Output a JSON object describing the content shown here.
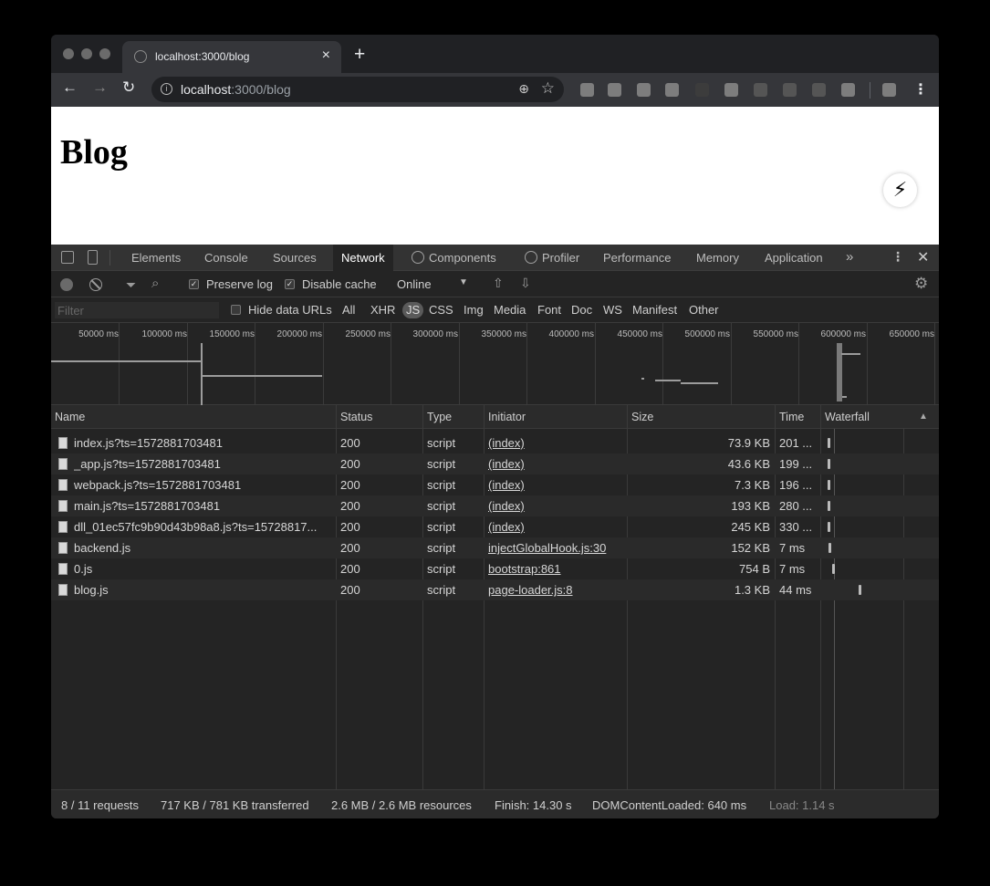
{
  "browser": {
    "tab_title": "localhost:3000/blog",
    "new_tab": "+",
    "tab_close": "×",
    "url_host": "localhost",
    "url_rest": ":3000/blog"
  },
  "page": {
    "heading": "Blog",
    "indicator_glyph": "⚡"
  },
  "devtools": {
    "tabs": [
      "Elements",
      "Console",
      "Sources",
      "Network",
      "Components",
      "Profiler",
      "Performance",
      "Memory",
      "Application"
    ],
    "active_tab": "Network",
    "more": "»"
  },
  "network_toolbar": {
    "preserve_log": "Preserve log",
    "preserve_log_checked": true,
    "disable_cache": "Disable cache",
    "disable_cache_checked": true,
    "throttling": "Online"
  },
  "filter_bar": {
    "placeholder": "Filter",
    "hide_data_urls": "Hide data URLs",
    "types": [
      "All",
      "XHR",
      "JS",
      "CSS",
      "Img",
      "Media",
      "Font",
      "Doc",
      "WS",
      "Manifest",
      "Other"
    ],
    "active_type": "JS"
  },
  "overview": {
    "ticks": [
      "50000 ms",
      "100000 ms",
      "150000 ms",
      "200000 ms",
      "250000 ms",
      "300000 ms",
      "350000 ms",
      "400000 ms",
      "450000 ms",
      "500000 ms",
      "550000 ms",
      "600000 ms",
      "650000 ms"
    ]
  },
  "table": {
    "columns": [
      "Name",
      "Status",
      "Type",
      "Initiator",
      "Size",
      "Time",
      "Waterfall"
    ],
    "rows": [
      {
        "name": "index.js?ts=1572881703481",
        "status": "200",
        "type": "script",
        "initiator": "(index)",
        "size": "73.9 KB",
        "time": "201 ..."
      },
      {
        "name": "_app.js?ts=1572881703481",
        "status": "200",
        "type": "script",
        "initiator": "(index)",
        "size": "43.6 KB",
        "time": "199 ..."
      },
      {
        "name": "webpack.js?ts=1572881703481",
        "status": "200",
        "type": "script",
        "initiator": "(index)",
        "size": "7.3 KB",
        "time": "196 ..."
      },
      {
        "name": "main.js?ts=1572881703481",
        "status": "200",
        "type": "script",
        "initiator": "(index)",
        "size": "193 KB",
        "time": "280 ..."
      },
      {
        "name": "dll_01ec57fc9b90d43b98a8.js?ts=15728817...",
        "status": "200",
        "type": "script",
        "initiator": "(index)",
        "size": "245 KB",
        "time": "330 ..."
      },
      {
        "name": "backend.js",
        "status": "200",
        "type": "script",
        "initiator": "injectGlobalHook.js:30",
        "size": "152 KB",
        "time": "7 ms"
      },
      {
        "name": "0.js",
        "status": "200",
        "type": "script",
        "initiator": "bootstrap:861",
        "size": "754 B",
        "time": "7 ms"
      },
      {
        "name": "blog.js",
        "status": "200",
        "type": "script",
        "initiator": "page-loader.js:8",
        "size": "1.3 KB",
        "time": "44 ms"
      }
    ]
  },
  "status_bar": {
    "requests": "8 / 11 requests",
    "transferred": "717 KB / 781 KB transferred",
    "resources": "2.6 MB / 2.6 MB resources",
    "finish": "Finish: 14.30 s",
    "dom_content_loaded": "DOMContentLoaded: 640 ms",
    "load": "Load: 1.14 s"
  }
}
